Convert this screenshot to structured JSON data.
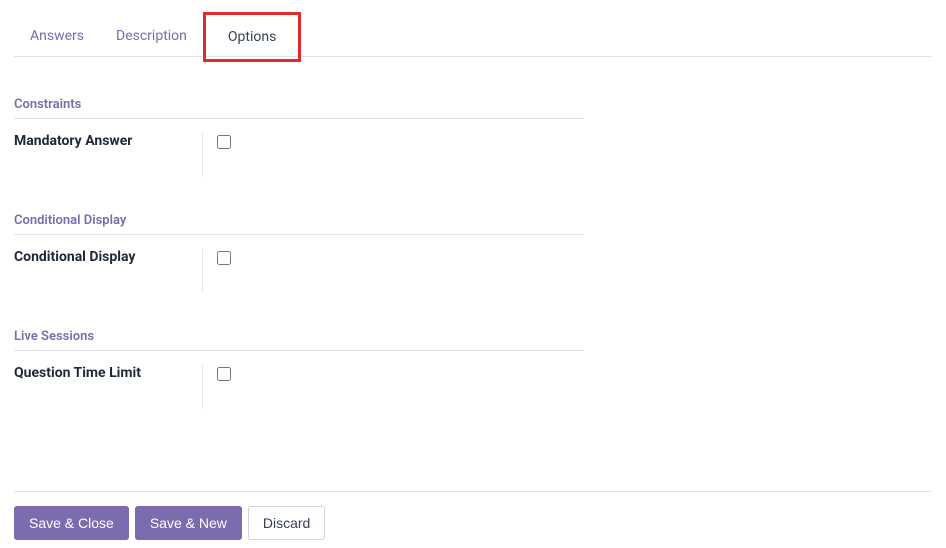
{
  "tabs": {
    "answers": "Answers",
    "description": "Description",
    "options": "Options"
  },
  "sections": {
    "constraints": {
      "title": "Constraints",
      "mandatory_label": "Mandatory Answer"
    },
    "conditional": {
      "title": "Conditional Display",
      "conditional_label": "Conditional Display"
    },
    "live": {
      "title": "Live Sessions",
      "time_limit_label": "Question Time Limit"
    }
  },
  "footer": {
    "save_close": "Save & Close",
    "save_new": "Save & New",
    "discard": "Discard"
  }
}
